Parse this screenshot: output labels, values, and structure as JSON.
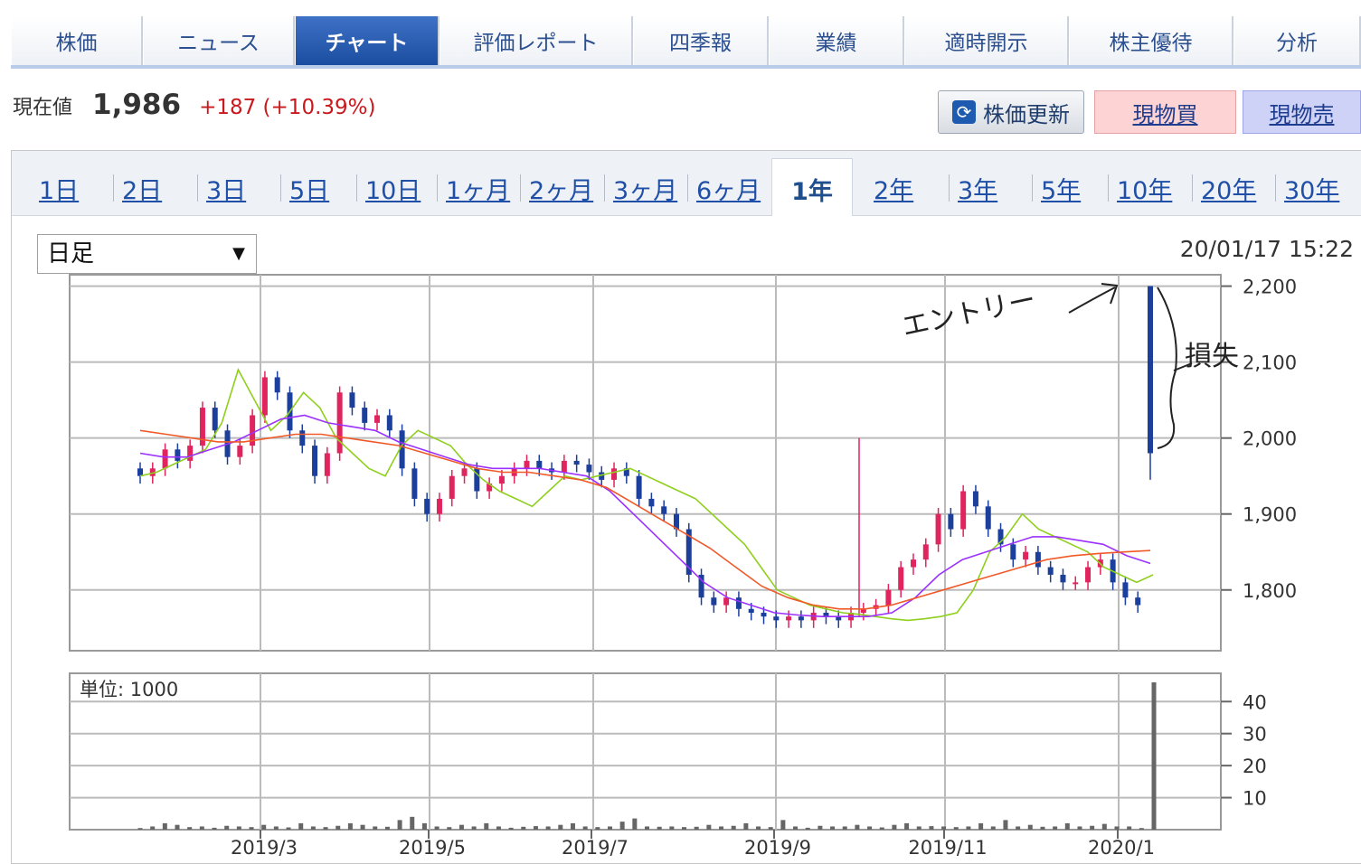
{
  "top_tabs": [
    {
      "label": "株価",
      "active": false
    },
    {
      "label": "ニュース",
      "active": false
    },
    {
      "label": "チャート",
      "active": true
    },
    {
      "label": "評価レポート",
      "active": false
    },
    {
      "label": "四季報",
      "active": false
    },
    {
      "label": "業績",
      "active": false
    },
    {
      "label": "適時開示",
      "active": false
    },
    {
      "label": "株主優待",
      "active": false
    },
    {
      "label": "分析",
      "active": false
    }
  ],
  "price": {
    "label": "現在値",
    "value": "1,986",
    "change": "+187 (+10.39%)"
  },
  "buttons": {
    "refresh": "株価更新",
    "buy": "現物買",
    "sell": "現物売"
  },
  "periods": [
    "1日",
    "2日",
    "3日",
    "5日",
    "10日",
    "1ヶ月",
    "2ヶ月",
    "3ヶ月",
    "6ヶ月",
    "1年",
    "2年",
    "3年",
    "5年",
    "10年",
    "20年",
    "30年"
  ],
  "active_period": "1年",
  "interval_select": "日足",
  "timestamp": "20/01/17 15:22",
  "volume_unit_label": "単位: 1000",
  "annotations": {
    "entry": "エントリー",
    "loss": "損失"
  },
  "colors": {
    "up": "#e0245e",
    "down": "#1d3f9c",
    "ma_short": "#8fcf1d",
    "ma_mid": "#9b30ff",
    "ma_long": "#f05a28",
    "volume": "#666666"
  },
  "chart_data": [
    {
      "type": "candlestick",
      "title": "",
      "xlabel": "",
      "ylabel": "",
      "x_ticks": [
        "2019/3",
        "2019/5",
        "2019/7",
        "2019/9",
        "2019/11",
        "2020/1"
      ],
      "y_ticks": [
        1800,
        1900,
        2000,
        2100,
        2200
      ],
      "ylim": [
        1720,
        2215
      ],
      "grid": true,
      "series_close": [
        1950,
        1960,
        1985,
        1970,
        1990,
        2040,
        2010,
        1975,
        1990,
        2030,
        2080,
        2060,
        2010,
        1990,
        1950,
        1980,
        2060,
        2040,
        2020,
        2030,
        2010,
        1960,
        1920,
        1900,
        1920,
        1950,
        1960,
        1930,
        1940,
        1950,
        1960,
        1970,
        1960,
        1955,
        1970,
        1965,
        1955,
        1945,
        1960,
        1950,
        1920,
        1910,
        1900,
        1880,
        1820,
        1790,
        1780,
        1790,
        1775,
        1770,
        1765,
        1760,
        1765,
        1760,
        1770,
        1765,
        1760,
        1770,
        1775,
        1780,
        1800,
        1830,
        1840,
        1860,
        1900,
        1880,
        1930,
        1910,
        1880,
        1860,
        1840,
        1850,
        1830,
        1820,
        1810,
        1810,
        1830,
        1840,
        1810,
        1790,
        1780,
        1986
      ],
      "ma_short": [
        1950,
        1955,
        1965,
        1975,
        1985,
        2020,
        2090,
        2050,
        2010,
        2030,
        2060,
        2040,
        2000,
        1980,
        1960,
        1950,
        1990,
        2010,
        2000,
        1990,
        1965,
        1945,
        1930,
        1920,
        1910,
        1930,
        1950,
        1945,
        1950,
        1955,
        1960,
        1950,
        1940,
        1930,
        1920,
        1900,
        1880,
        1860,
        1830,
        1800,
        1790,
        1780,
        1775,
        1770,
        1768,
        1765,
        1762,
        1760,
        1762,
        1765,
        1770,
        1800,
        1850,
        1870,
        1900,
        1880,
        1870,
        1860,
        1850,
        1830,
        1820,
        1810,
        1820
      ],
      "ma_mid": [
        1980,
        1975,
        1975,
        1985,
        1995,
        2010,
        2025,
        2030,
        2020,
        2015,
        2010,
        1995,
        1985,
        1975,
        1965,
        1960,
        1960,
        1960,
        1955,
        1950,
        1930,
        1900,
        1870,
        1840,
        1810,
        1790,
        1780,
        1770,
        1767,
        1765,
        1765,
        1765,
        1770,
        1790,
        1820,
        1840,
        1850,
        1860,
        1870,
        1870,
        1865,
        1860,
        1845,
        1835
      ],
      "ma_long": [
        2010,
        2005,
        2000,
        1995,
        1995,
        2000,
        2005,
        2005,
        2000,
        1995,
        1990,
        1980,
        1970,
        1960,
        1955,
        1955,
        1950,
        1945,
        1935,
        1915,
        1895,
        1875,
        1855,
        1830,
        1805,
        1790,
        1780,
        1775,
        1775,
        1780,
        1790,
        1800,
        1810,
        1820,
        1830,
        1840,
        1845,
        1848,
        1850,
        1852
      ]
    },
    {
      "type": "bar",
      "title": "",
      "ylabel": "単位: 1000",
      "y_ticks": [
        10,
        30,
        20,
        40
      ],
      "ylim": [
        0,
        46
      ],
      "values": [
        0.5,
        1,
        2,
        1.5,
        0.8,
        1,
        0.6,
        1.2,
        1,
        0.8,
        1.5,
        1,
        0.7,
        2,
        1,
        0.8,
        1.2,
        2,
        1.5,
        1,
        0.9,
        3,
        4,
        2,
        1,
        0.8,
        1.5,
        1,
        2,
        1,
        0.6,
        0.9,
        1.1,
        1,
        1.5,
        2,
        1,
        0.8,
        1,
        2.5,
        3.5,
        1,
        0.9,
        1,
        0.8,
        0.9,
        1.5,
        1,
        1.2,
        2,
        1,
        0.8,
        3,
        1,
        0.6,
        1.2,
        1,
        1,
        1.5,
        1,
        0.7,
        1.5,
        2,
        1,
        1.1,
        1,
        0.8,
        1,
        2,
        1,
        3,
        1,
        1.5,
        0.9,
        1,
        2,
        1,
        1.2,
        1.8,
        1,
        1,
        0.5,
        46
      ]
    }
  ]
}
